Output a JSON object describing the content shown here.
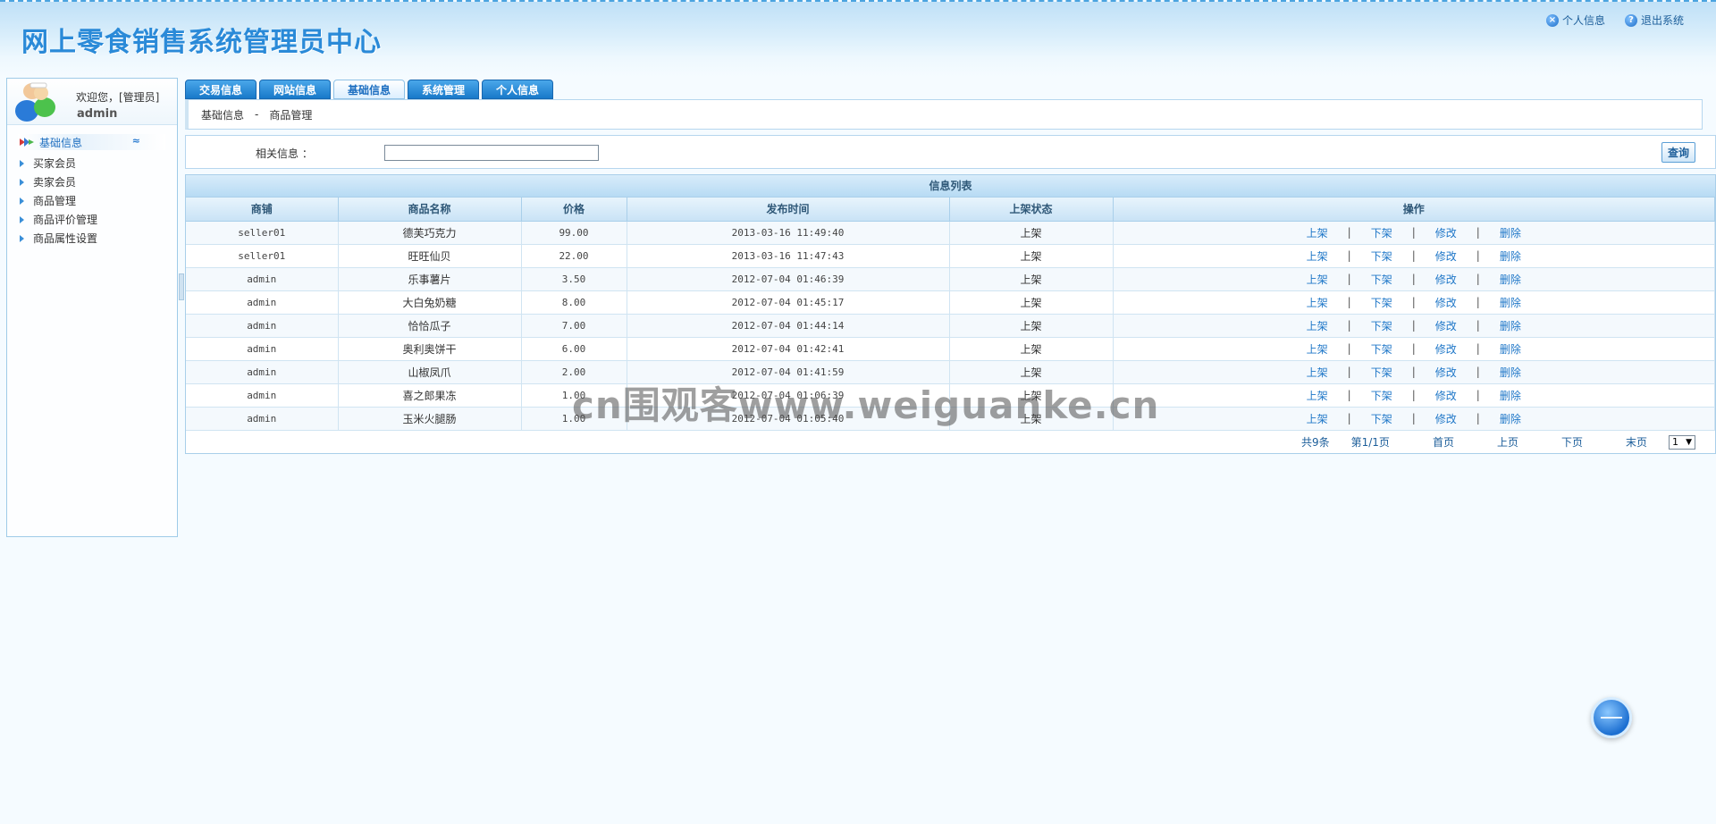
{
  "header": {
    "title": "网上零食销售系统管理员中心",
    "links": [
      {
        "label": "个人信息",
        "icon": "x-icon",
        "glyph": "×"
      },
      {
        "label": "退出系统",
        "icon": "help-icon",
        "glyph": "?"
      }
    ]
  },
  "sidebar": {
    "welcome": "欢迎您，[管理员]",
    "username": "admin",
    "menu_title": "基础信息",
    "collapse_glyph": "≈",
    "items": [
      "买家会员",
      "卖家会员",
      "商品管理",
      "商品评价管理",
      "商品属性设置"
    ]
  },
  "tabs": [
    "交易信息",
    "网站信息",
    "基础信息",
    "系统管理",
    "个人信息"
  ],
  "active_tab": 2,
  "breadcrumb": {
    "parent": "基础信息",
    "sep": "-",
    "current": "商品管理"
  },
  "search": {
    "label": "相关信息 ：",
    "value": "",
    "button": "查询"
  },
  "list": {
    "title": "信息列表",
    "columns": [
      "商铺",
      "商品名称",
      "价格",
      "发布时间",
      "上架状态",
      "操作"
    ],
    "actions": [
      "上架",
      "下架",
      "修改",
      "删除"
    ],
    "action_sep": "|",
    "rows": [
      {
        "shop": "seller01",
        "name": "德芙巧克力",
        "price": "99.00",
        "time": "2013-03-16 11:49:40",
        "status": "上架"
      },
      {
        "shop": "seller01",
        "name": "旺旺仙贝",
        "price": "22.00",
        "time": "2013-03-16 11:47:43",
        "status": "上架"
      },
      {
        "shop": "admin",
        "name": "乐事薯片",
        "price": "3.50",
        "time": "2012-07-04 01:46:39",
        "status": "上架"
      },
      {
        "shop": "admin",
        "name": "大白兔奶糖",
        "price": "8.00",
        "time": "2012-07-04 01:45:17",
        "status": "上架"
      },
      {
        "shop": "admin",
        "name": "恰恰瓜子",
        "price": "7.00",
        "time": "2012-07-04 01:44:14",
        "status": "上架"
      },
      {
        "shop": "admin",
        "name": "奥利奥饼干",
        "price": "6.00",
        "time": "2012-07-04 01:42:41",
        "status": "上架"
      },
      {
        "shop": "admin",
        "name": "山椒凤爪",
        "price": "2.00",
        "time": "2012-07-04 01:41:59",
        "status": "上架"
      },
      {
        "shop": "admin",
        "name": "喜之郎果冻",
        "price": "1.00",
        "time": "2012-07-04 01:06:39",
        "status": "上架"
      },
      {
        "shop": "admin",
        "name": "玉米火腿肠",
        "price": "1.00",
        "time": "2012-07-04 01:05:40",
        "status": "上架"
      }
    ]
  },
  "pager": {
    "total": "共9条",
    "page": "第1/1页",
    "first": "首页",
    "prev": "上页",
    "next": "下页",
    "last": "末页",
    "select_value": "1",
    "select_arrow": "▼"
  },
  "watermark": "cn围观客www.weiguanke.cn",
  "colors": {
    "accent": "#2a8ad8",
    "tab": "#1879c9",
    "link": "#1f77c8",
    "border": "#a9cfea"
  }
}
